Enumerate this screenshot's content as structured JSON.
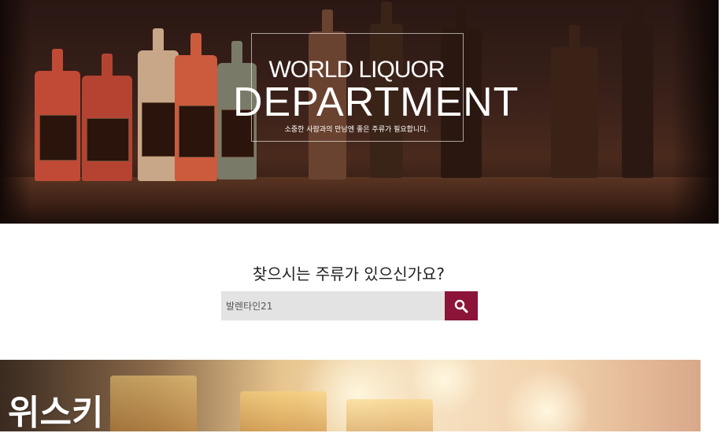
{
  "hero": {
    "title_small": "WORLD LIQUOR",
    "title_large": "DEPARTMENT",
    "subtitle": "소중한 사람과의 만남엔 좋은 주류가 필요합니다."
  },
  "search": {
    "heading": "찾으시는 주류가 있으신가요?",
    "input_value": "발렌타인21",
    "button_icon": "search-icon"
  },
  "category_banner": {
    "title": "위스키"
  },
  "colors": {
    "accent": "#8c1438",
    "input_bg": "#e3e3e3"
  }
}
